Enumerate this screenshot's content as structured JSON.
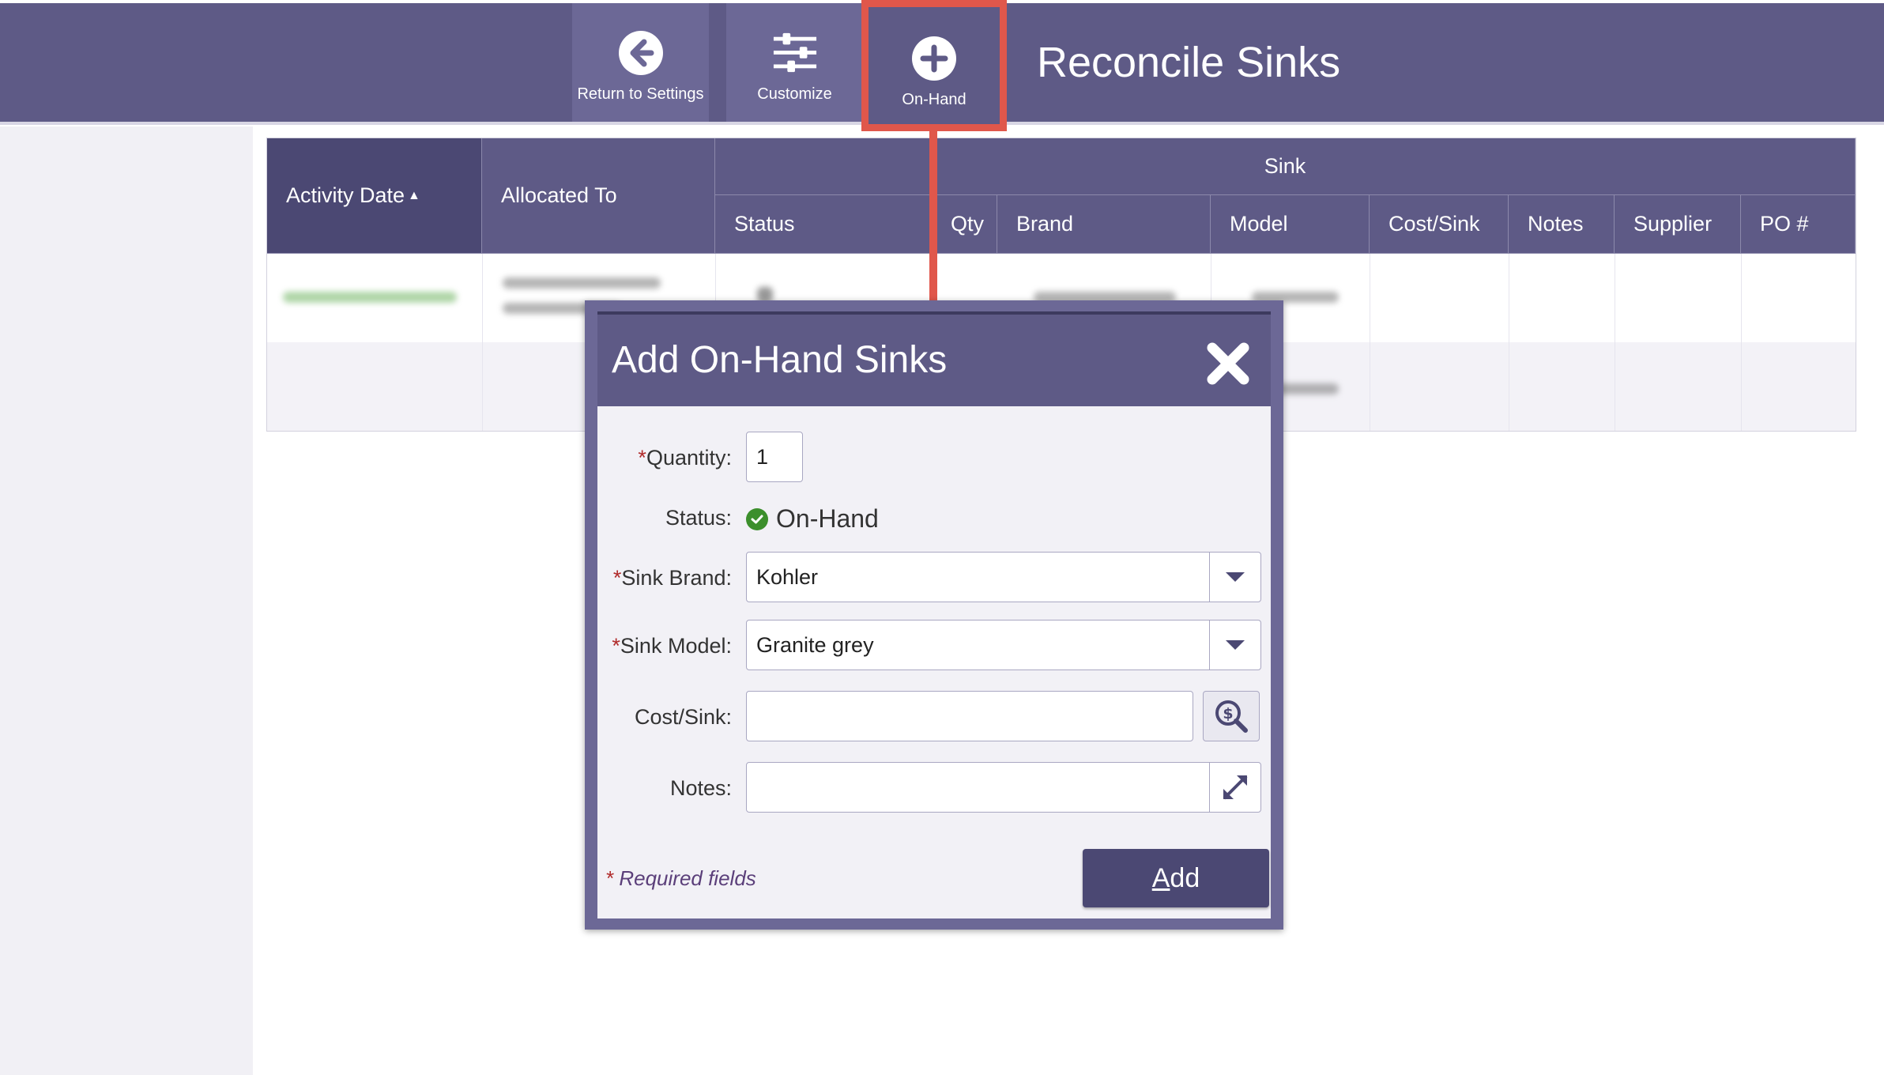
{
  "toolbar": {
    "return_label": "Return to Settings",
    "customize_label": "Customize",
    "onhand_label": "On-Hand"
  },
  "page": {
    "title": "Reconcile Sinks"
  },
  "grid": {
    "columns": {
      "activity_date": "Activity Date",
      "allocated_to": "Allocated To",
      "sink_group": "Sink",
      "status": "Status",
      "qty": "Qty",
      "brand": "Brand",
      "model": "Model",
      "cost_sink": "Cost/Sink",
      "notes": "Notes",
      "supplier": "Supplier",
      "po": "PO #"
    },
    "sort_indicator": "▲"
  },
  "dialog": {
    "title": "Add On-Hand Sinks",
    "fields": {
      "quantity": {
        "label": "Quantity:",
        "value": "1",
        "required": "*"
      },
      "status": {
        "label": "Status:",
        "value": "On-Hand"
      },
      "sink_brand": {
        "label": "Sink Brand:",
        "value": "Kohler",
        "required": "*"
      },
      "sink_model": {
        "label": "Sink Model:",
        "value": "Granite grey",
        "required": "*"
      },
      "cost_sink": {
        "label": "Cost/Sink:",
        "value": ""
      },
      "notes": {
        "label": "Notes:",
        "value": ""
      }
    },
    "required_note": {
      "asterisk": "*",
      "text": " Required fields"
    },
    "add_button": {
      "accel": "A",
      "rest": "dd"
    }
  },
  "colors": {
    "header": "#5e5a86",
    "accent_highlight": "#e0574b",
    "status_ok": "#3c8f2c"
  }
}
